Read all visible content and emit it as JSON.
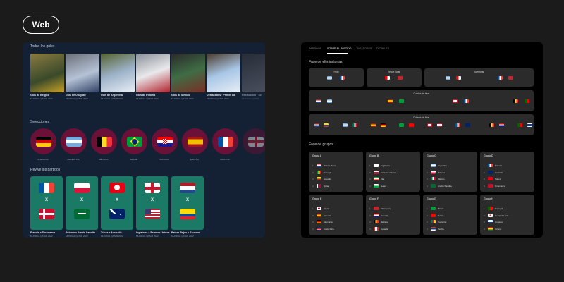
{
  "badge": "Web",
  "left": {
    "goals_title": "Todos los goles",
    "goals": [
      {
        "title": "Gols de Bélgica",
        "sub": "MUNDIAL QATAR 2022"
      },
      {
        "title": "Gols de Uruguay",
        "sub": "MUNDIAL QATAR 2022"
      },
      {
        "title": "Gols de Argentina",
        "sub": "MUNDIAL QATAR 2022"
      },
      {
        "title": "Gols de Polonia",
        "sub": "MUNDIAL QATAR 2022"
      },
      {
        "title": "Gols de México",
        "sub": "MUNDIAL QATAR 2022"
      },
      {
        "title": "Destacados · Primer día",
        "sub": "MUNDIAL QATAR 2022"
      },
      {
        "title": "Destacados · Se",
        "sub": "MUNDIAL QATAR"
      }
    ],
    "teams_title": "Selecciones",
    "teams": [
      "ALEMANIA",
      "ARGENTINA",
      "BÉLGICA",
      "BRASIL",
      "CROACIA",
      "ESPAÑA",
      "FRANCIA",
      ""
    ],
    "matches_title": "Revive los partidos",
    "matches": [
      {
        "title": "Francia x Dinamarca",
        "sub": "MUNDIAL QATAR 2022"
      },
      {
        "title": "Polonia x Arabia Saudita",
        "sub": "MUNDIAL QATAR 2022"
      },
      {
        "title": "Túnez x Australia",
        "sub": "MUNDIAL QATAR 2022"
      },
      {
        "title": "Inglaterra x Estados Unidos",
        "sub": "MUNDIAL QATAR 2022"
      },
      {
        "title": "Países Bajos x Ecuador",
        "sub": "MUNDIAL QATAR 2022"
      }
    ],
    "vs": "X"
  },
  "right": {
    "tabs": [
      "PARTIDOS",
      "SOBRE EL PARTIDO",
      "JUGADORES",
      "DETALLES"
    ],
    "knockout_title": "Fase de eliminatorias",
    "final_label": "Final",
    "third_label": "Tercer lugar",
    "semis_label": "Semifinal",
    "quarters_label": "Cuartos de final",
    "r16_label": "Octavos de final",
    "groups_title": "Fase de grupos",
    "groups": [
      {
        "name": "Grupo A",
        "teams": [
          "Países Bajos",
          "Senegal",
          "Ecuador",
          "Qatar"
        ]
      },
      {
        "name": "Grupo B",
        "teams": [
          "Inglaterra",
          "Estados Unidos",
          "Irán",
          "Gales"
        ]
      },
      {
        "name": "Grupo C",
        "teams": [
          "Argentina",
          "Polonia",
          "México",
          "Arabia Saudita"
        ]
      },
      {
        "name": "Grupo D",
        "teams": [
          "Francia",
          "Australia",
          "Túnez",
          "Dinamarca"
        ]
      },
      {
        "name": "Grupo E",
        "teams": [
          "Japón",
          "España",
          "Alemania",
          "Costa Rica"
        ]
      },
      {
        "name": "Grupo F",
        "teams": [
          "Marruecos",
          "Croacia",
          "Bélgica",
          "Canadá"
        ]
      },
      {
        "name": "Grupo G",
        "teams": [
          "Brasil",
          "Suiza",
          "Camerún",
          "Serbia"
        ]
      },
      {
        "name": "Grupo H",
        "teams": [
          "Portugal",
          "Corea del Sur",
          "Uruguay",
          "Ghana"
        ]
      }
    ]
  },
  "colors": {
    "bg": "#1b1b1b",
    "left_panel": "#142034",
    "team_circle": "#6b1138",
    "match_card": "#1a7a66"
  }
}
